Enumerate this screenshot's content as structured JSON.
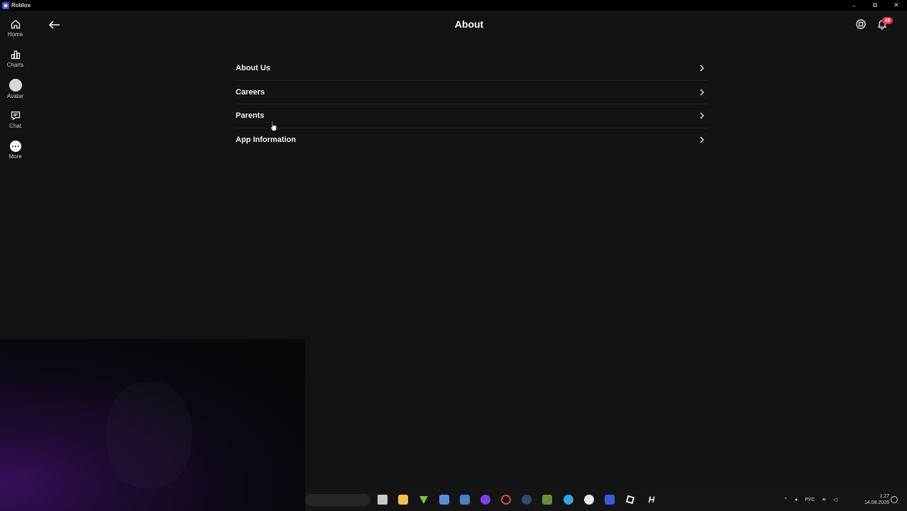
{
  "window": {
    "title": "Roblox",
    "controls": {
      "minimize": "–",
      "maximize": "⧉",
      "close": "✕"
    }
  },
  "nav": {
    "items": [
      {
        "label": "Home",
        "icon": "home-icon"
      },
      {
        "label": "Charts",
        "icon": "charts-icon"
      },
      {
        "label": "Avatar",
        "icon": "avatar-icon"
      },
      {
        "label": "Chat",
        "icon": "chat-icon"
      },
      {
        "label": "More",
        "icon": "more-icon"
      }
    ]
  },
  "header": {
    "title": "About",
    "notification_count": "28"
  },
  "menu": {
    "items": [
      {
        "label": "About Us"
      },
      {
        "label": "Careers"
      },
      {
        "label": "Parents"
      },
      {
        "label": "App Information"
      }
    ]
  },
  "taskbar": {
    "icons": [
      "file-explorer-icon",
      "folder-icon",
      "vegas-icon",
      "calculator-icon",
      "mail-icon",
      "discord-icon",
      "chrome-icon",
      "steam-icon",
      "minecraft-icon",
      "telegram-icon",
      "yandex-icon",
      "roblox-icon",
      "roblox-studio-icon",
      "hypixel-icon"
    ],
    "language": "РУС",
    "time": "1:27",
    "date": "14.08.2026"
  },
  "colors": {
    "background": "#111214",
    "badge": "#e5343e",
    "divider": "#222327"
  }
}
